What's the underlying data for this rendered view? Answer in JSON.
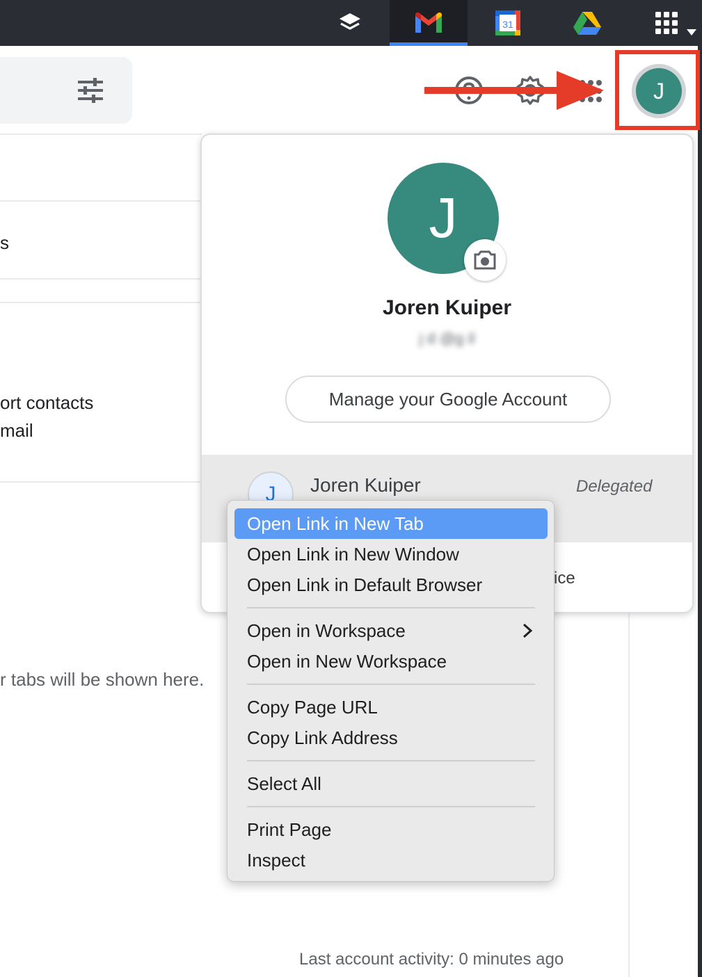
{
  "appbar": {
    "tabs": [
      {
        "name": "layers-app-icon",
        "active": false
      },
      {
        "name": "gmail-icon",
        "active": true
      },
      {
        "name": "google-calendar-icon",
        "active": false,
        "label": "31"
      },
      {
        "name": "google-drive-icon",
        "active": false
      },
      {
        "name": "apps-grid-icon",
        "active": false
      }
    ]
  },
  "background": {
    "line1_tail": "s",
    "line2": "ort contacts",
    "line3": " mail",
    "line4": "r tabs will be shown here.",
    "footer": "Last account activity: 0 minutes ago"
  },
  "header_icons": [
    "tune-icon",
    "help-icon",
    "settings-icon",
    "apps-icon"
  ],
  "account_popup": {
    "avatar_letter": "J",
    "name": "Joren Kuiper",
    "email": "j     d @g     il",
    "manage_label": "Manage your Google Account",
    "account_row": {
      "avatar_letter": "J",
      "name": "Joren Kuiper",
      "badge": "Delegated"
    },
    "tail_text": "ice"
  },
  "small_avatar_letter": "J",
  "context_menu": {
    "groups": [
      [
        "Open Link in New Tab",
        "Open Link in New Window",
        "Open Link in Default Browser"
      ],
      [
        "Open in Workspace",
        "Open in New Workspace"
      ],
      [
        "Copy Page URL",
        "Copy Link Address"
      ],
      [
        "Select All"
      ],
      [
        "Print Page",
        "Inspect"
      ]
    ],
    "items": {
      "open_new_tab": "Open Link in New Tab",
      "open_new_window": "Open Link in New Window",
      "open_default_browser": "Open Link in Default Browser",
      "open_in_workspace": "Open in Workspace",
      "open_new_workspace": "Open in New Workspace",
      "copy_page_url": "Copy Page URL",
      "copy_link_address": "Copy Link Address",
      "select_all": "Select All",
      "print_page": "Print Page",
      "inspect": "Inspect"
    },
    "highlighted": "Open Link in New Tab"
  },
  "colors": {
    "appbar": "#2b2d34",
    "avatar": "#378a7e",
    "annotation_red": "#e53c29",
    "menu_highlight": "#5c9bf5"
  }
}
